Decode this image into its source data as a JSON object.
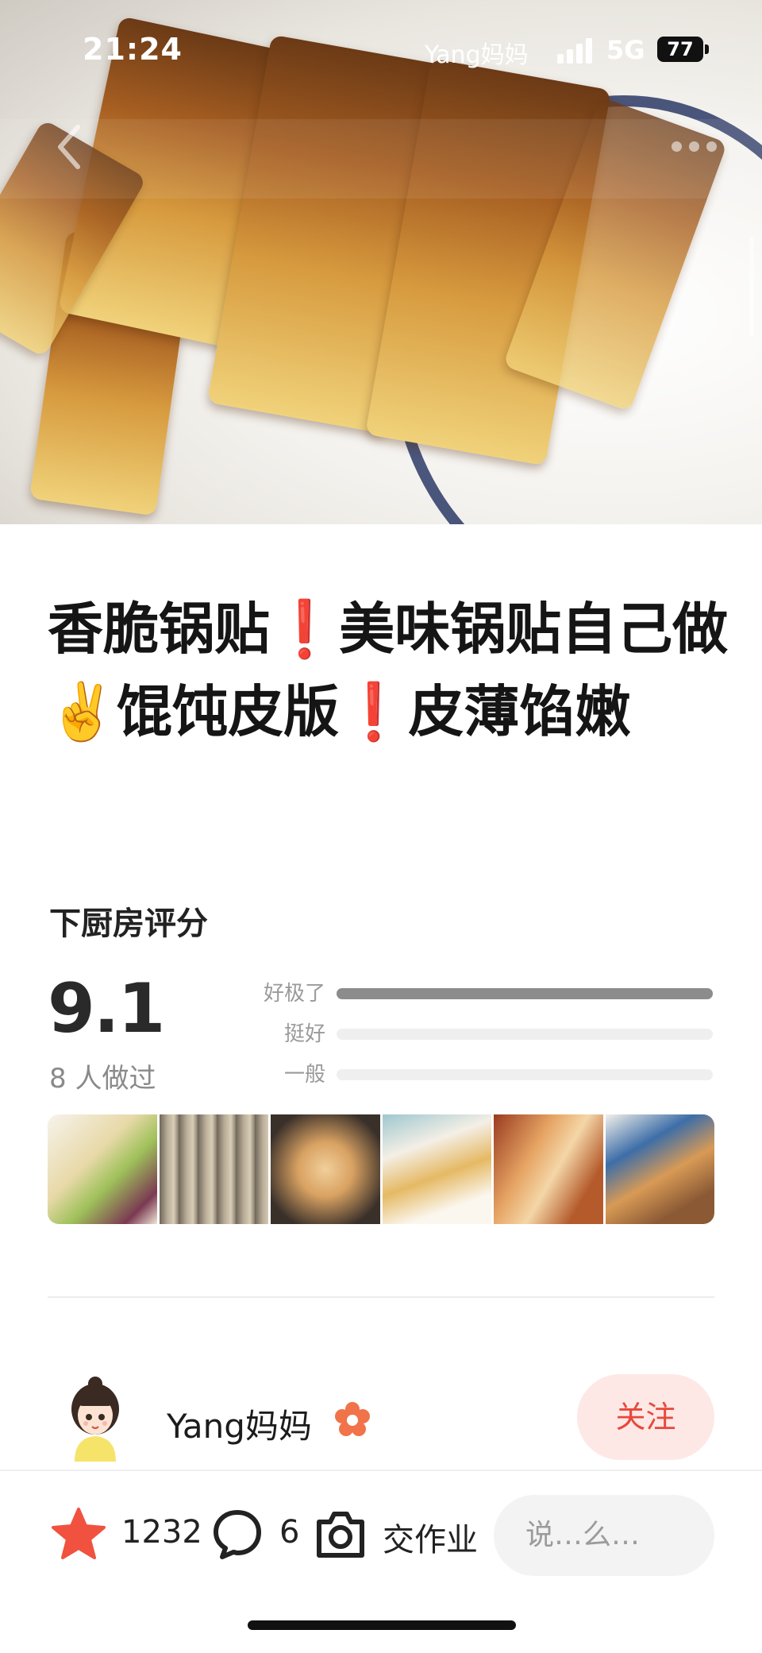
{
  "status_bar": {
    "time": "21:24",
    "carrier": "Yang妈妈",
    "network": "5G",
    "battery": "77"
  },
  "recipe": {
    "title_parts": [
      "香脆锅贴",
      "❗",
      "美味锅贴自己做",
      "✌️",
      "馄饨皮版",
      "❗",
      "皮薄馅嫩"
    ]
  },
  "rating": {
    "label": "下厨房评分",
    "score": "9.1",
    "made_count": "8 人做过",
    "breakdown": [
      {
        "label": "好极了",
        "fraction": 1.0
      },
      {
        "label": "挺好",
        "fraction": 0.0
      },
      {
        "label": "一般",
        "fraction": 0.0
      }
    ]
  },
  "author": {
    "name": "Yang妈妈",
    "follow_label": "关注"
  },
  "bottom_bar": {
    "likes": "1232",
    "comments": "6",
    "homework_label": "交作业",
    "comment_placeholder": "说…么…"
  },
  "colors": {
    "accent_red": "#e8483a",
    "star": "#f0523f",
    "follow_bg": "#fde8e6"
  },
  "icons": [
    "back-arrow-icon",
    "more-dots-icon",
    "star-icon",
    "comment-bubble-icon",
    "camera-icon",
    "verified-flower-icon"
  ]
}
